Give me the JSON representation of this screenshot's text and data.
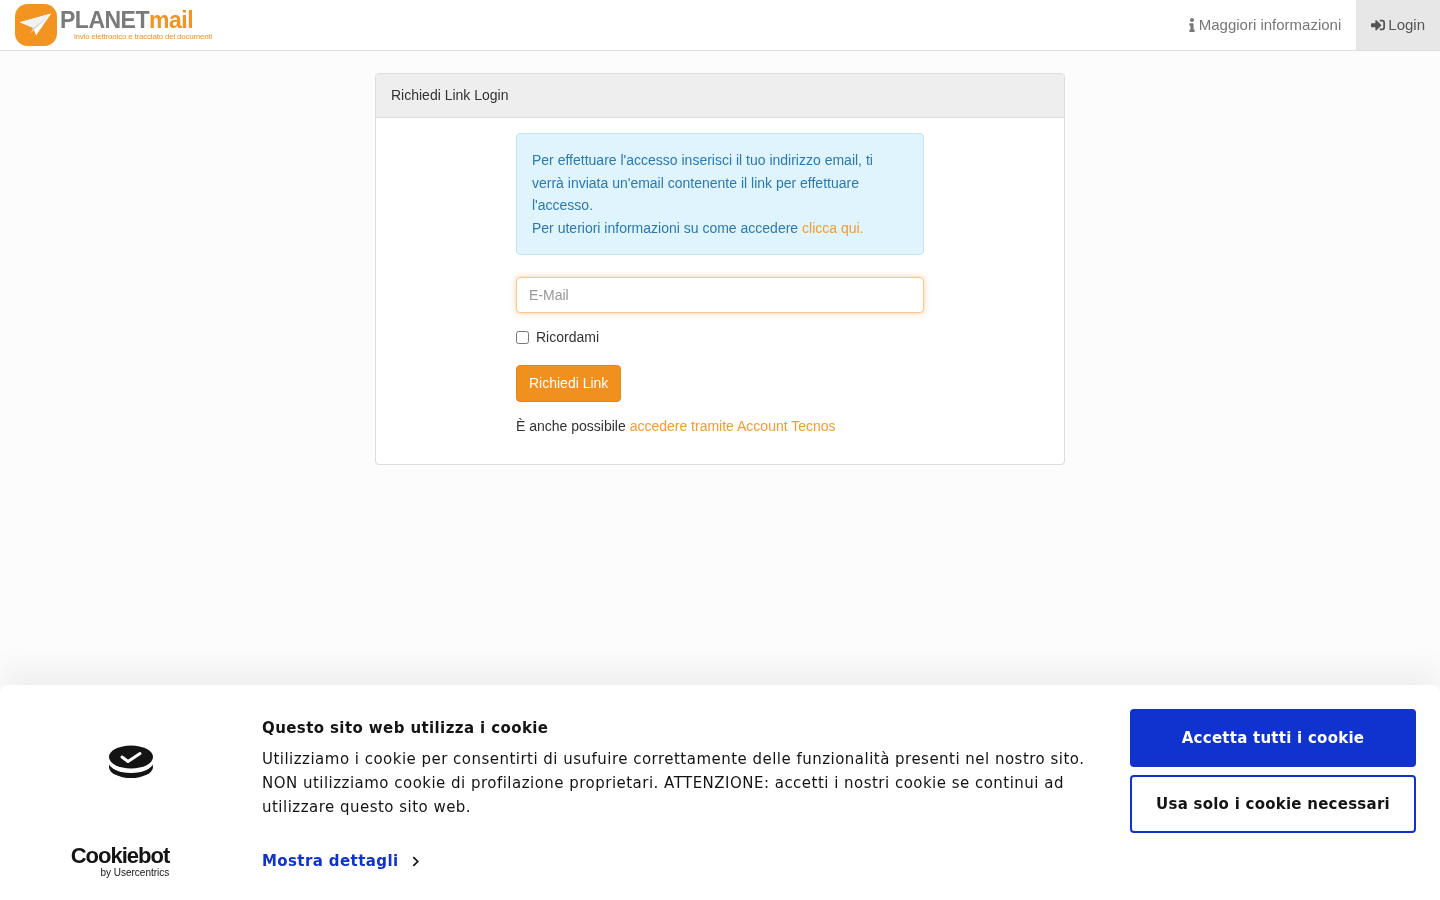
{
  "navbar": {
    "logo": {
      "word": "PLANET",
      "accent": "mail",
      "tagline": "invio elettronico e tracciato dei documenti"
    },
    "links": [
      {
        "label": "Maggiori informazioni",
        "kind": "info",
        "selected": false
      },
      {
        "label": "Login",
        "kind": "login",
        "selected": true
      }
    ]
  },
  "panel": {
    "title": "Richiedi Link Login",
    "alert": {
      "text": "Per effettuare l'accesso inserisci il tuo indirizzo email, ti verrà inviata un'email contenente il link per effettuare l'accesso.",
      "more": {
        "before": "Per uteriori informazioni su come accedere ",
        "link": "clicca qui."
      }
    },
    "email": {
      "placeholder": "E-Mail"
    },
    "remember": {
      "label": "Ricordami",
      "checked": false
    },
    "submit": "Richiedi Link",
    "alt": {
      "before": "È anche possibile ",
      "link": "accedere tramite Account Tecnos"
    }
  },
  "cookie_banner": {
    "brand": "Cookiebot",
    "brand_sub": "by Usercentrics",
    "title": "Questo sito web utilizza i cookie",
    "body": "Utilizziamo i cookie per consentirti di usufuire correttamente delle funzionalità presenti nel nostro sito. NON utilizziamo cookie di profilazione proprietari. ATTENZIONE: accetti i nostri cookie se continui ad utilizzare questo sito web.",
    "details_link": "Mostra dettagli",
    "buttons": [
      {
        "label": "Accetta tutti i cookie",
        "kind": "primary"
      },
      {
        "label": "Usa solo i cookie necessari",
        "kind": "outline"
      }
    ]
  }
}
